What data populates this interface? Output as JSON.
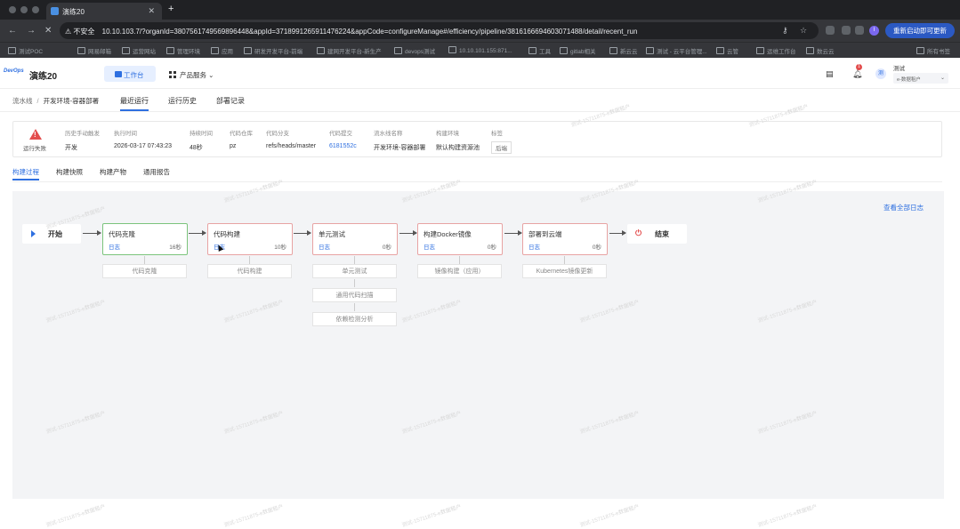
{
  "browser": {
    "tab_title": "演练20",
    "new_tab": "+",
    "security": "不安全",
    "url": "10.10.103.7/?organId=3807561749569896448&appId=3718991265911476224&appCode=configureManage#/efficiency/pipeline/3816166694603071488/detail/recent_run",
    "restart_label": "重新启动即可更新",
    "profile_initial": "I",
    "bookmarks": [
      "测试POC",
      "网易邮箱",
      "运营网站",
      "管理环境",
      "应用",
      "研发开发平台-前端",
      "建网开发平台-新生产",
      "devops测试",
      "10.10.101.155:871...",
      "工具",
      "gitlab相关",
      "新云云",
      "测试 - 云平台管理...",
      "云管",
      "运维工作台",
      "数云云"
    ],
    "bookmarks_right": "所有书签"
  },
  "app": {
    "logo": "DevOps",
    "name": "演练20",
    "workbench": "工作台",
    "products": "产品服务",
    "notification_count": "1",
    "user_avatar": "测",
    "user_name": "测试",
    "tenant": "e-数据租户"
  },
  "breadcrumb": {
    "root": "流水线",
    "separator": "/",
    "current": "开发环境-容器部署"
  },
  "top_tabs": [
    "最近运行",
    "运行历史",
    "部署记录"
  ],
  "run_info": {
    "status": "运行失败",
    "fields": [
      {
        "key": "历史手动触发",
        "value": "开发"
      },
      {
        "key": "执行时间",
        "value": "2026-03-17 07:43:23"
      },
      {
        "key": "持续时间",
        "value": "48秒"
      },
      {
        "key": "代码仓库",
        "value": "pz"
      },
      {
        "key": "代码分支",
        "value": "refs/heads/master"
      },
      {
        "key": "代码提交",
        "value": "6181552c"
      },
      {
        "key": "流水线名称",
        "value": "开发环境-容器部署"
      },
      {
        "key": "构建环境",
        "value": "默认构建资源池"
      },
      {
        "key": "标签",
        "value": "后端"
      }
    ]
  },
  "sub_tabs": [
    "构建过程",
    "构建快照",
    "构建产物",
    "通用报告"
  ],
  "pipeline": {
    "view_log": "查看全部日志",
    "start": "开始",
    "end": "结束",
    "log_label": "日志",
    "stages": [
      {
        "name": "代码克隆",
        "time": "16秒",
        "jobs": [
          "代码克隆"
        ]
      },
      {
        "name": "代码构建",
        "time": "10秒",
        "jobs": [
          "代码构建"
        ]
      },
      {
        "name": "单元测试",
        "time": "0秒",
        "jobs": [
          "单元测试",
          "通用代码扫描",
          "依赖检测分析"
        ]
      },
      {
        "name": "构建Docker镜像",
        "time": "0秒",
        "jobs": [
          "镜像构建（应用）"
        ]
      },
      {
        "name": "部署到云端",
        "time": "0秒",
        "jobs": [
          "Kubernetes镜像更新"
        ]
      }
    ]
  },
  "watermark": "测试-15711875-e数据租户"
}
